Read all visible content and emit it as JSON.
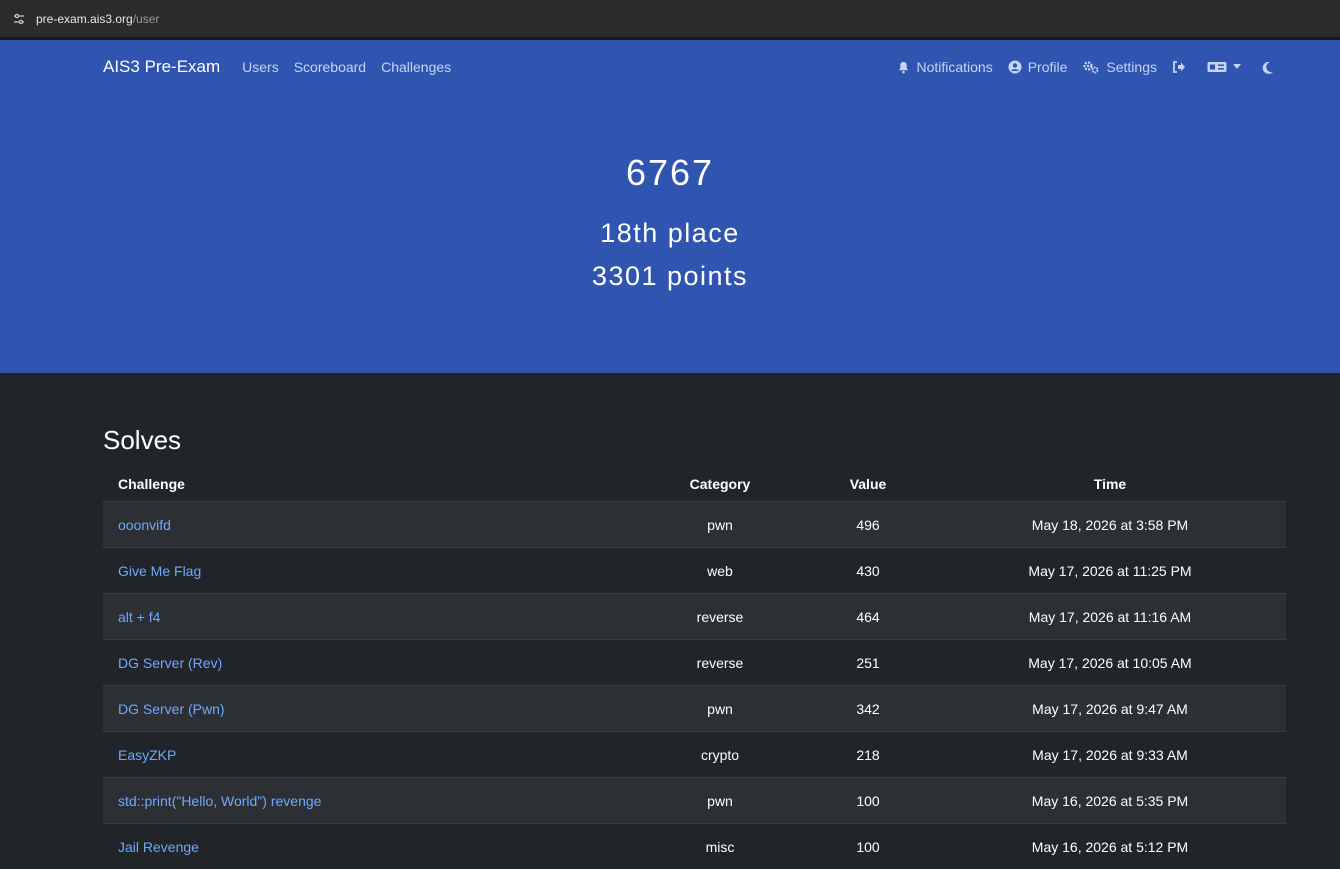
{
  "browser": {
    "host": "pre-exam.ais3.org",
    "path": "/user"
  },
  "nav": {
    "brand": "AIS3 Pre-Exam",
    "links": [
      "Users",
      "Scoreboard",
      "Challenges"
    ],
    "notifications": "Notifications",
    "profile": "Profile",
    "settings": "Settings"
  },
  "user": {
    "name": "6767",
    "place": "18th place",
    "points": "3301 points"
  },
  "solves": {
    "title": "Solves",
    "headers": {
      "challenge": "Challenge",
      "category": "Category",
      "value": "Value",
      "time": "Time"
    },
    "rows": [
      {
        "challenge": "ooonvifd",
        "category": "pwn",
        "value": "496",
        "time": "May 18, 2026 at 3:58 PM"
      },
      {
        "challenge": "Give Me Flag",
        "category": "web",
        "value": "430",
        "time": "May 17, 2026 at 11:25 PM"
      },
      {
        "challenge": "alt + f4",
        "category": "reverse",
        "value": "464",
        "time": "May 17, 2026 at 11:16 AM"
      },
      {
        "challenge": "DG Server (Rev)",
        "category": "reverse",
        "value": "251",
        "time": "May 17, 2026 at 10:05 AM"
      },
      {
        "challenge": "DG Server (Pwn)",
        "category": "pwn",
        "value": "342",
        "time": "May 17, 2026 at 9:47 AM"
      },
      {
        "challenge": "EasyZKP",
        "category": "crypto",
        "value": "218",
        "time": "May 17, 2026 at 9:33 AM"
      },
      {
        "challenge": "std::print(\"Hello, World\") revenge",
        "category": "pwn",
        "value": "100",
        "time": "May 16, 2026 at 5:35 PM"
      },
      {
        "challenge": "Jail Revenge",
        "category": "misc",
        "value": "100",
        "time": "May 16, 2026 at 5:12 PM"
      }
    ]
  }
}
